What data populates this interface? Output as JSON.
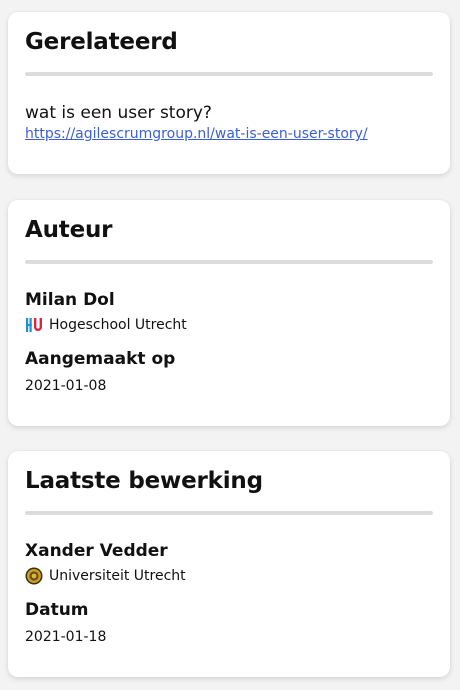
{
  "related": {
    "heading": "Gerelateerd",
    "title": "wat is een user story?",
    "link": "https://agilescrumgroup.nl/wat-is-een-user-story/"
  },
  "author": {
    "heading": "Auteur",
    "name": "Milan Dol",
    "org": "Hogeschool Utrecht",
    "org_icon": "hu-logo-icon",
    "created_label": "Aangemaakt op",
    "created_value": "2021-01-08"
  },
  "last_edit": {
    "heading": "Laatste bewerking",
    "name": "Xander Vedder",
    "org": "Universiteit Utrecht",
    "org_icon": "uu-seal-icon",
    "date_label": "Datum",
    "date_value": "2021-01-18"
  },
  "colors": {
    "link": "#3c5fd6",
    "divider": "#dcdcdc",
    "hu_blue": "#1f8fd1",
    "hu_red": "#d7263d",
    "uu_gold": "#c9a227"
  }
}
